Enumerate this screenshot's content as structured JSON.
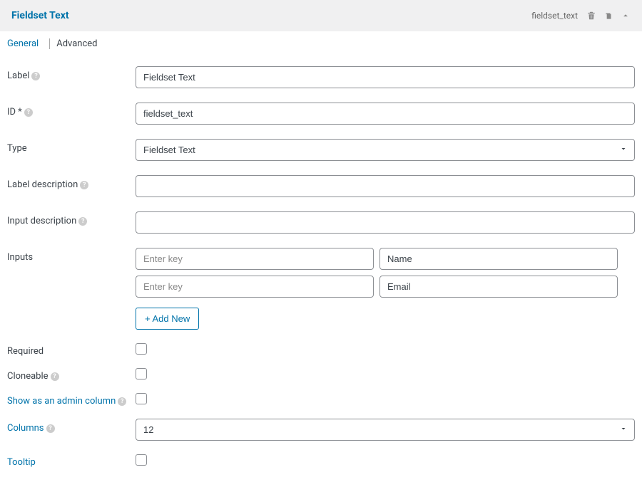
{
  "header": {
    "title": "Fieldset Text",
    "slug": "fieldset_text"
  },
  "tabs": [
    {
      "label": "General",
      "active": true
    },
    {
      "label": "Advanced",
      "active": false
    }
  ],
  "fields": {
    "label": {
      "label": "Label",
      "value": "Fieldset Text",
      "help": true
    },
    "id": {
      "label": "ID",
      "required": true,
      "value": "fieldset_text",
      "help": true
    },
    "type": {
      "label": "Type",
      "value": "Fieldset Text"
    },
    "label_desc": {
      "label": "Label description",
      "value": "",
      "help": true
    },
    "input_desc": {
      "label": "Input description",
      "value": "",
      "help": true
    },
    "inputs": {
      "label": "Inputs",
      "rows": [
        {
          "key": "",
          "value": "Name"
        },
        {
          "key": "",
          "value": "Email"
        }
      ],
      "key_placeholder": "Enter key",
      "add_label": "+ Add New"
    },
    "required": {
      "label": "Required",
      "checked": false
    },
    "cloneable": {
      "label": "Cloneable",
      "checked": false,
      "help": true
    },
    "admin_col": {
      "label": "Show as an admin column",
      "checked": false,
      "link": true,
      "help": true
    },
    "columns": {
      "label": "Columns",
      "value": "12",
      "link": true,
      "help": true
    },
    "tooltip": {
      "label": "Tooltip",
      "checked": false,
      "link": true
    }
  }
}
